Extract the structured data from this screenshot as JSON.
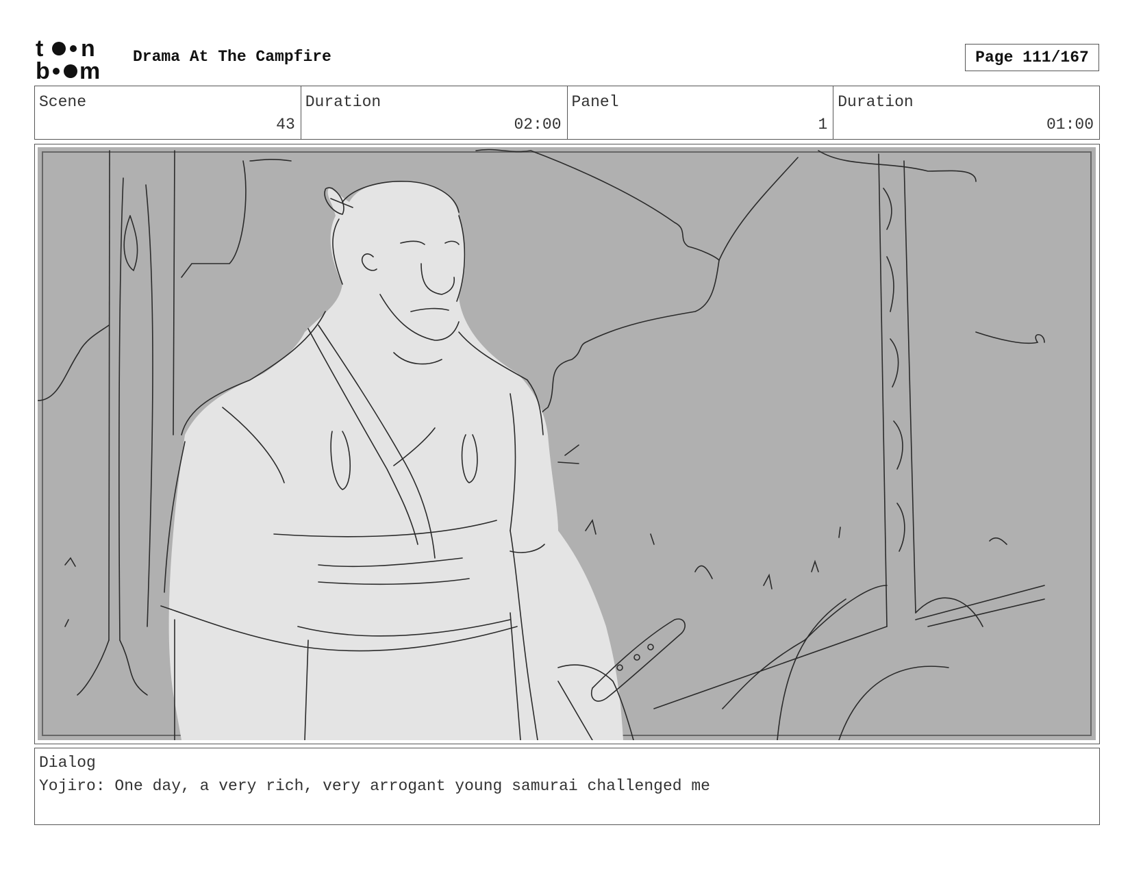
{
  "header": {
    "logo_text": "toon boom",
    "title": "Drama At The Campfire",
    "page": "Page 111/167"
  },
  "info": {
    "scene_label": "Scene",
    "scene_value": "43",
    "scene_duration_label": "Duration",
    "scene_duration_value": "02:00",
    "panel_label": "Panel",
    "panel_value": "1",
    "panel_duration_label": "Duration",
    "panel_duration_value": "01:00"
  },
  "dialog": {
    "label": "Dialog",
    "text": "Yojiro: One day, a very rich, very arrogant young samurai challenged me"
  },
  "colors": {
    "background_gray": "#b0b0b0",
    "figure_fill": "#e4e4e4",
    "line": "#2a2a2a"
  }
}
